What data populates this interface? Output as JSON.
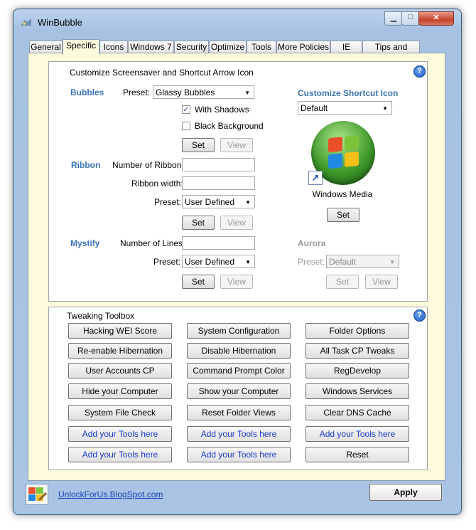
{
  "window": {
    "title": "WinBubble"
  },
  "tabs": [
    {
      "label": "General"
    },
    {
      "label": "Specific"
    },
    {
      "label": "Icons"
    },
    {
      "label": "Windows 7"
    },
    {
      "label": "Security"
    },
    {
      "label": "Optimize"
    },
    {
      "label": "Tools"
    },
    {
      "label": "More Policies"
    },
    {
      "label": "IE"
    },
    {
      "label": "Tips and Tricks"
    }
  ],
  "screensaver_group": {
    "title": "Customize Screensaver and Shortcut Arrow Icon",
    "help": "?",
    "bubbles": {
      "label": "Bubbles",
      "preset_label": "Preset:",
      "preset_value": "Glassy Bubbles",
      "with_shadows_label": "With Shadows",
      "with_shadows_checked": true,
      "black_background_label": "Black Background",
      "black_background_checked": false,
      "set": "Set",
      "view": "View"
    },
    "ribbon": {
      "label": "Ribbon",
      "number_label": "Number of Ribbons:",
      "width_label": "Ribbon width:",
      "preset_label": "Preset:",
      "preset_value": "User Defined",
      "set": "Set",
      "view": "View"
    },
    "mystify": {
      "label": "Mystify",
      "lines_label": "Number of Lines:",
      "preset_label": "Preset:",
      "preset_value": "User Defined",
      "set": "Set",
      "view": "View"
    },
    "shortcut_icon": {
      "label": "Customize Shortcut Icon",
      "preset_value": "Default",
      "preview_caption": "Windows Media",
      "set": "Set"
    },
    "aurora": {
      "label": "Aurora",
      "preset_label": "Preset:",
      "preset_value": "Default",
      "set": "Set",
      "view": "View"
    }
  },
  "toolbox": {
    "title": "Tweaking Toolbox",
    "help": "?",
    "rows": [
      [
        "Hacking WEI Score",
        "System Configuration",
        "Folder Options"
      ],
      [
        "Re-enable Hibernation",
        "Disable Hibernation",
        "All Task CP Tweaks"
      ],
      [
        "User Accounts CP",
        "Command Prompt Color",
        "RegDevelop"
      ],
      [
        "Hide your Computer",
        "Show your Computer",
        "Windows Services"
      ],
      [
        "System File Check",
        "Reset Folder Views",
        "Clear DNS Cache"
      ],
      [
        "Add your Tools here",
        "Add your Tools here",
        "Add your Tools here"
      ],
      [
        "Add your Tools here",
        "Add your Tools here",
        "Reset"
      ]
    ]
  },
  "footer": {
    "link": "UnlockForUs.BlogSpot.com",
    "apply": "Apply"
  },
  "colors": {
    "section_heading": "#3b74b8",
    "panel_bg": "#fdfbdc",
    "custom_tool_text": "#1a3ad0"
  }
}
